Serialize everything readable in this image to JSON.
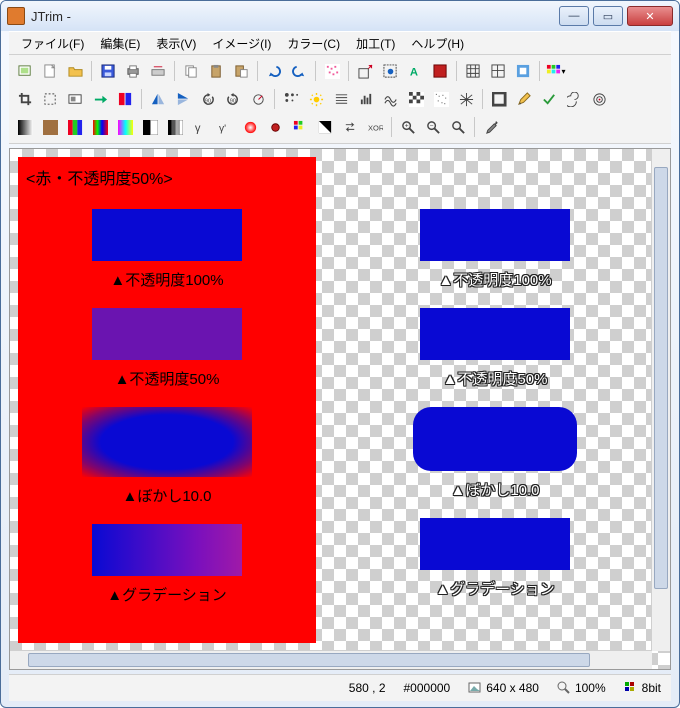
{
  "title": "JTrim -",
  "menus": {
    "file": "ファイル(F)",
    "edit": "編集(E)",
    "view": "表示(V)",
    "image": "イメージ(I)",
    "color": "カラー(C)",
    "process": "加工(T)",
    "help": "ヘルプ(H)"
  },
  "canvas": {
    "left_header": "<赤・不透明度50%>",
    "labels": {
      "op100": "▲不透明度100%",
      "op50": "▲不透明度50%",
      "blur": "▲ぼかし10.0",
      "grad": "▲グラデーション"
    },
    "right_labels": {
      "op100": "▲不透明度100%",
      "op50": "▲不透明度50%",
      "blur": "▲ぼかし10.0",
      "grad": "▲グラデーション"
    }
  },
  "status": {
    "coords": "580 , 2",
    "color": "#000000",
    "dims": "640 x 480",
    "zoom": "100%",
    "depth": "8bit"
  }
}
